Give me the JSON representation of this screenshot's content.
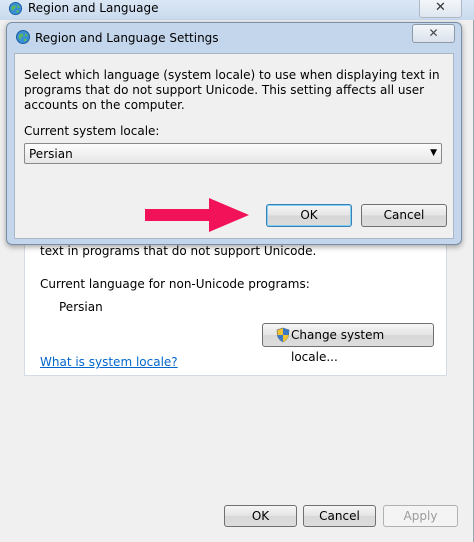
{
  "background_window": {
    "title": "Region and Language",
    "close_glyph": "✕",
    "unicode_text_partial": "text in programs that do not support Unicode.",
    "current_lang_label": "Current language for non-Unicode programs:",
    "current_lang_value": "Persian",
    "change_locale_label": "Change system locale...",
    "what_is_link": "What is system locale?",
    "buttons": {
      "ok": "OK",
      "cancel": "Cancel",
      "apply": "Apply"
    }
  },
  "dialog": {
    "title": "Region and Language Settings",
    "close_glyph": "✕",
    "description": "Select which language (system locale) to use when displaying text in programs that do not support Unicode. This setting affects all user accounts on the computer.",
    "locale_label": "Current system locale:",
    "locale_value": "Persian",
    "select_arrow": "▼",
    "ok_label": "OK",
    "cancel_label": "Cancel"
  },
  "annotation": {
    "arrow_color": "#f2125a",
    "points_to": "ok-button"
  }
}
